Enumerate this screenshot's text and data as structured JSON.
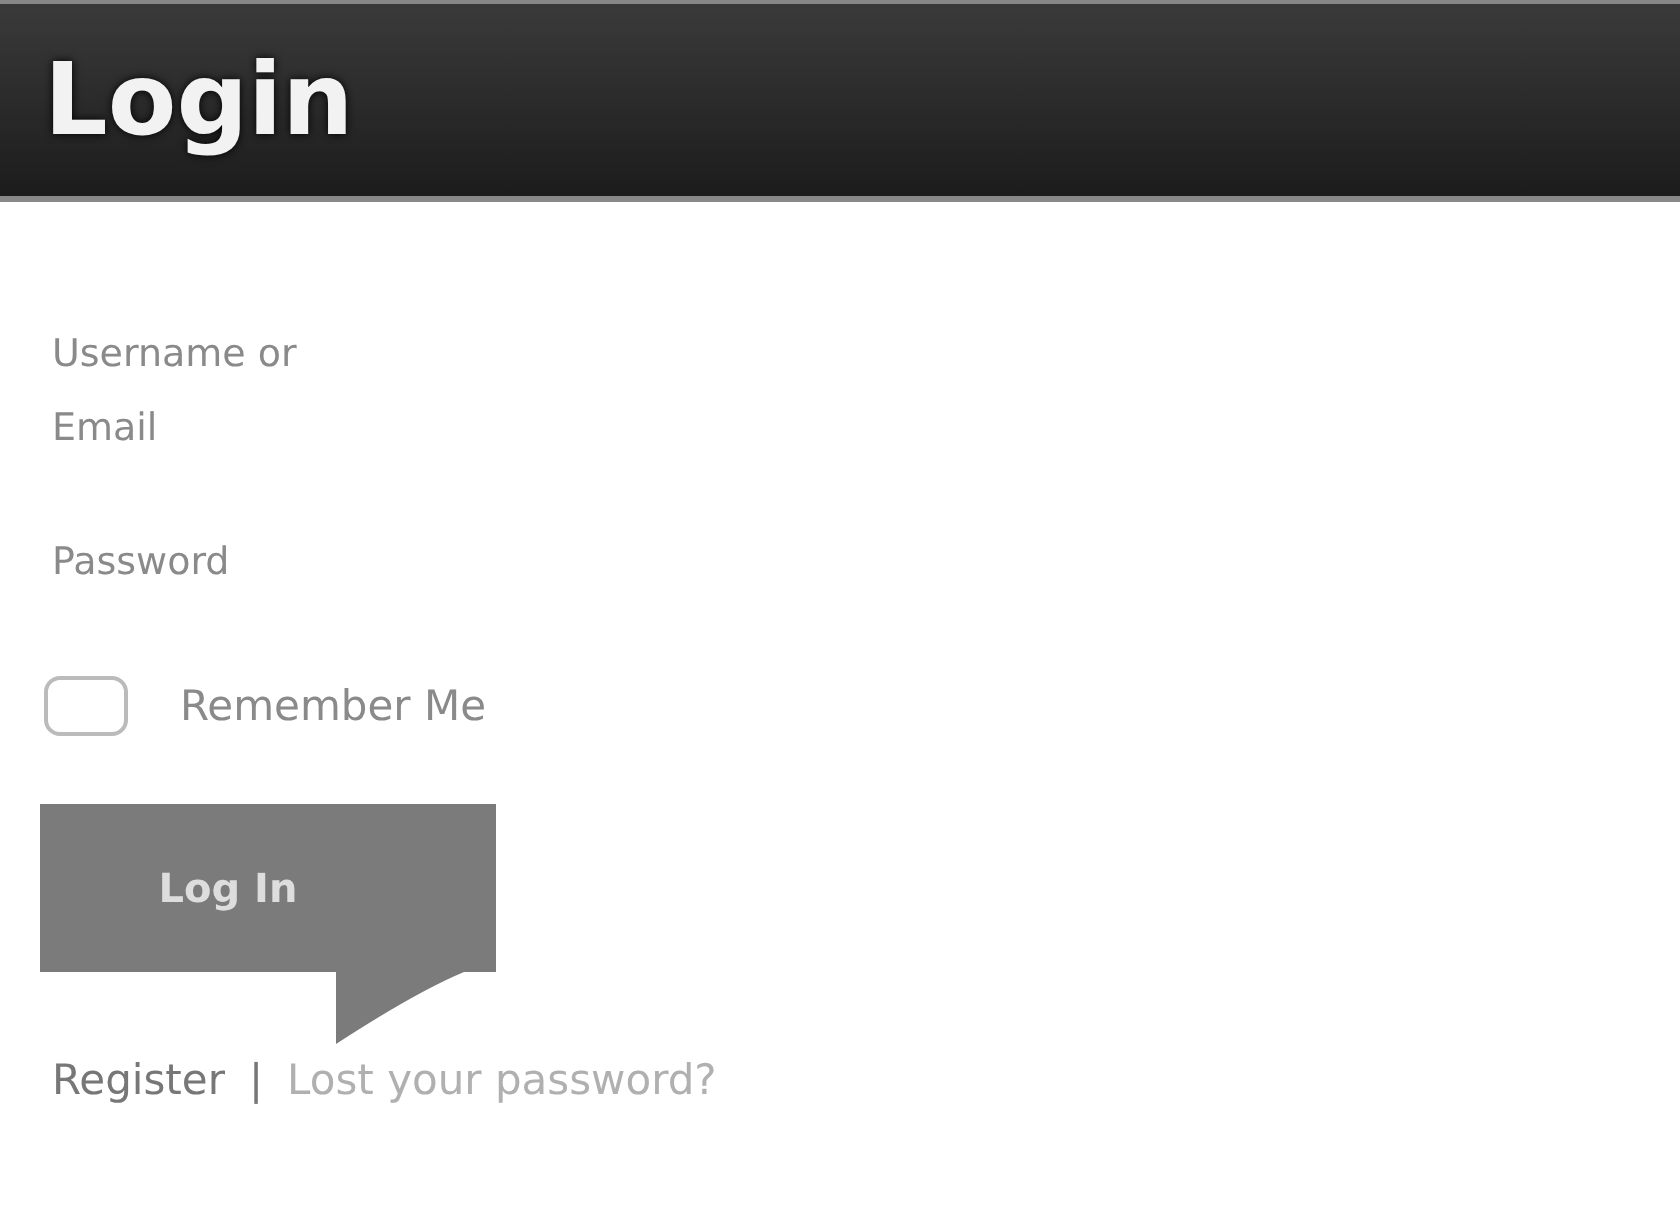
{
  "header": {
    "title": "Login"
  },
  "form": {
    "username_label": "Username or Email",
    "password_label": "Password",
    "remember": {
      "label": "Remember Me",
      "checked": false
    },
    "submit": "Log In"
  },
  "footer_links": [
    {
      "label": "Register",
      "kind": "primary"
    },
    {
      "label": "Lost your password?",
      "kind": "secondary"
    }
  ],
  "separator": "|"
}
